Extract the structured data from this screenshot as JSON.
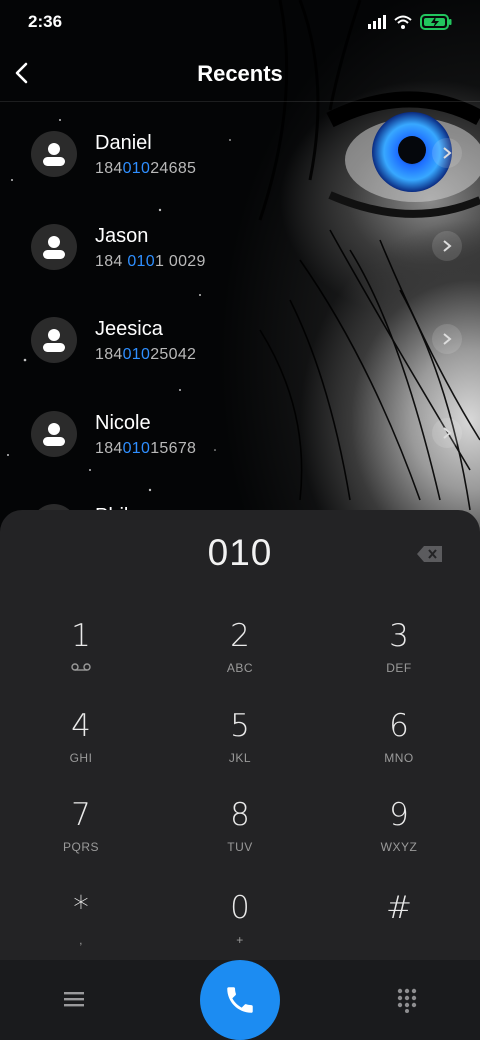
{
  "status_bar": {
    "time": "2:36"
  },
  "header": {
    "title": "Recents"
  },
  "recents": [
    {
      "name": "Daniel",
      "number_pre": "184",
      "number_match": "010",
      "number_post": "24685"
    },
    {
      "name": "Jason",
      "number_pre": "184 ",
      "number_match": "010",
      "number_post": "1 0029"
    },
    {
      "name": "Jeesica",
      "number_pre": "184",
      "number_match": "010",
      "number_post": "25042"
    },
    {
      "name": "Nicole",
      "number_pre": "184",
      "number_match": "010",
      "number_post": "15678"
    },
    {
      "name": "Phil",
      "number_pre": "",
      "number_match": "",
      "number_post": ""
    }
  ],
  "dialer": {
    "input": "010",
    "keys": [
      {
        "digit": "1",
        "letters": ""
      },
      {
        "digit": "2",
        "letters": "ABC"
      },
      {
        "digit": "3",
        "letters": "DEF"
      },
      {
        "digit": "4",
        "letters": "GHI"
      },
      {
        "digit": "5",
        "letters": "JKL"
      },
      {
        "digit": "6",
        "letters": "MNO"
      },
      {
        "digit": "7",
        "letters": "PQRS"
      },
      {
        "digit": "8",
        "letters": "TUV"
      },
      {
        "digit": "9",
        "letters": "WXYZ"
      },
      {
        "digit": "*",
        "letters": ","
      },
      {
        "digit": "0",
        "letters": "+"
      },
      {
        "digit": "#",
        "letters": ""
      }
    ]
  },
  "icons": {
    "back": "chevron-left-icon",
    "avatar": "person-icon",
    "row_action": "chevron-right-icon",
    "delete": "backspace-icon",
    "voicemail": "voicemail-icon",
    "menu": "menu-icon",
    "call": "phone-icon",
    "keypad": "dialpad-icon"
  },
  "colors": {
    "accent": "#1c8cf2",
    "match_highlight": "#2f8fff",
    "battery": "#22c55e",
    "dialer_bg": "#232325"
  }
}
